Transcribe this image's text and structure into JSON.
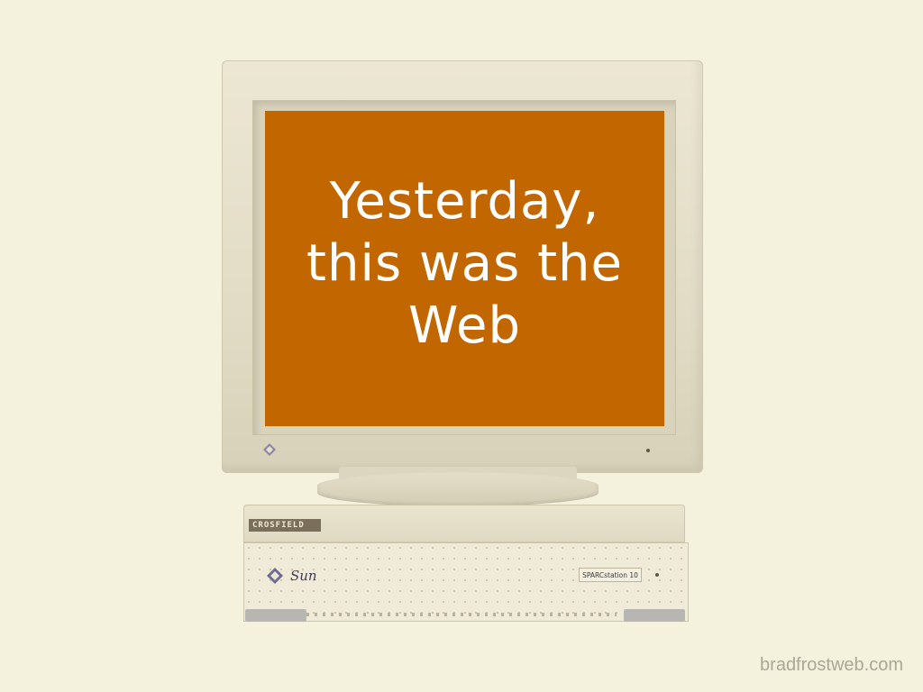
{
  "slide": {
    "heading_lines": [
      "Yesterday,",
      "this was the",
      "Web"
    ],
    "watermark": "bradfrostweb.com"
  },
  "computer": {
    "brand_badge": "CROSFIELD",
    "maker_label": "Sun",
    "model_label": "SPARCstation 10",
    "screen_color": "#c26700"
  }
}
